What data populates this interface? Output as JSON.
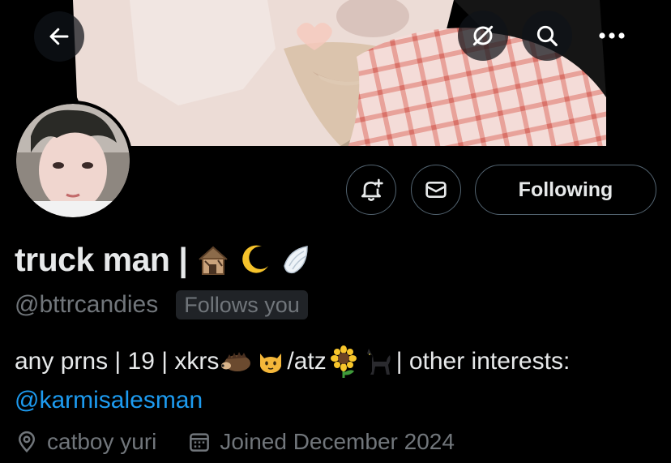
{
  "header": {
    "back_icon": "arrow-left-icon",
    "grok_icon": "grok-icon",
    "search_icon": "search-icon",
    "more_icon": "more-horizontal-icon"
  },
  "profile": {
    "display_name": "truck man |",
    "name_emojis": [
      "🏚",
      "🌙",
      "🪽"
    ],
    "handle": "@bttrcandies",
    "follows_you": "Follows you"
  },
  "actions": {
    "notify_icon": "bell-plus-icon",
    "message_icon": "envelope-icon",
    "following_label": "Following"
  },
  "bio": {
    "part1": "any prns | 19 | xkrs",
    "emoji1": "🦔",
    "emoji2": "🐱",
    "part2": "/atz",
    "emoji3": "🌻",
    "emoji4": "🐈‍⬛",
    "part3": "| other interests:",
    "mention": "@karmisalesman"
  },
  "meta": {
    "location": "catboy yuri",
    "joined": "Joined December 2024",
    "location_icon": "location-pin-icon",
    "calendar_icon": "calendar-icon"
  },
  "colors": {
    "background": "#000000",
    "text": "#e7e9ea",
    "secondary": "#71767b",
    "accent": "#1d9bf0",
    "border": "#536471"
  }
}
